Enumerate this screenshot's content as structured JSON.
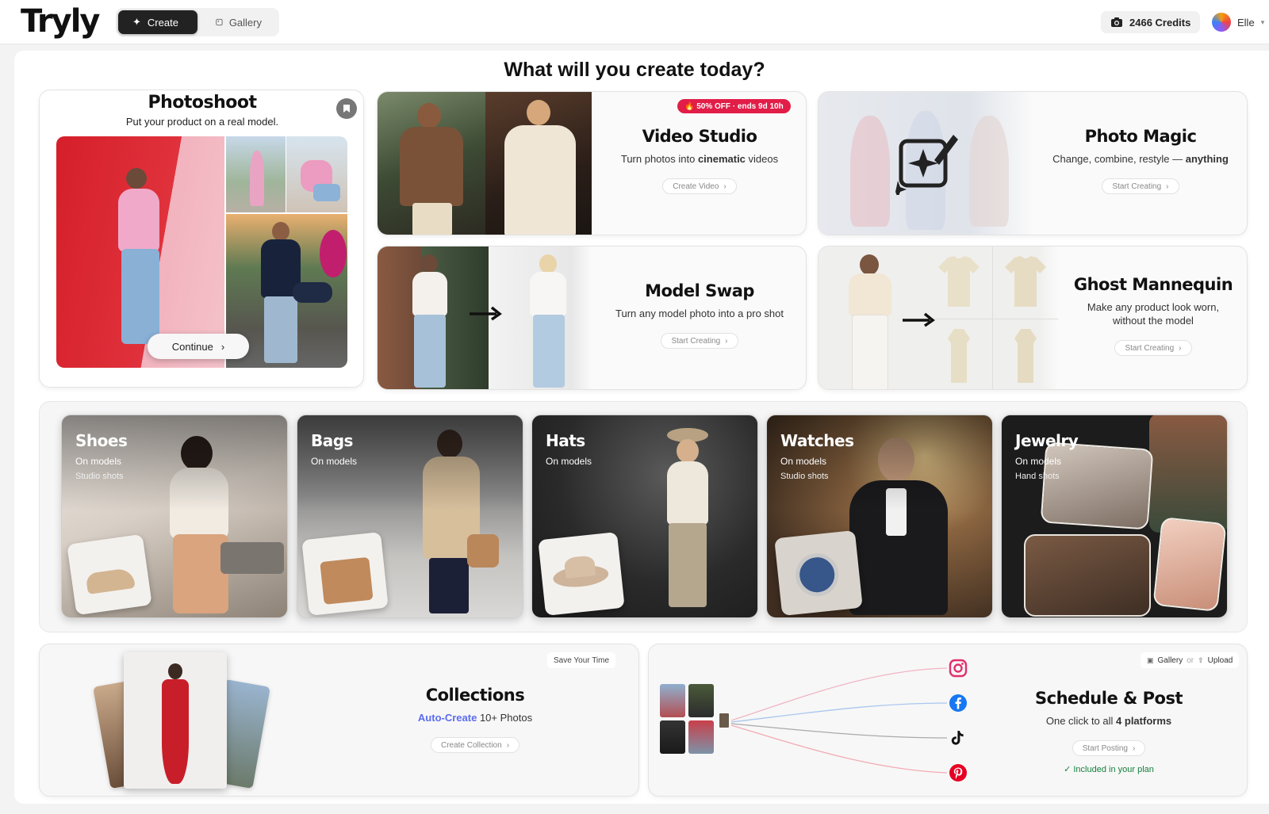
{
  "topbar": {
    "logo": "Tryly",
    "nav_create": "Create",
    "nav_gallery": "Gallery",
    "credits": "2466 Credits",
    "user_name": "Elle"
  },
  "page_title": "What will you create today?",
  "photoshoot": {
    "title": "Photoshoot",
    "subtitle": "Put your product on a real model.",
    "continue_label": "Continue"
  },
  "video_studio": {
    "badge": "🔥 50% OFF · ends 9d 10h",
    "title": "Video Studio",
    "subtitle_pre": "Turn photos into ",
    "subtitle_bold": "cinematic",
    "subtitle_post": " videos",
    "button": "Create Video"
  },
  "photo_magic": {
    "title": "Photo Magic",
    "subtitle_pre": "Change, combine, restyle — ",
    "subtitle_bold": "anything",
    "button": "Start Creating"
  },
  "model_swap": {
    "title": "Model Swap",
    "subtitle": "Turn any model photo into a pro shot",
    "button": "Start Creating"
  },
  "ghost_mannequin": {
    "title": "Ghost Mannequin",
    "subtitle_line1": "Make any product look worn,",
    "subtitle_line2": "without the model",
    "button": "Start Creating"
  },
  "categories": [
    {
      "name": "Shoes",
      "line1": "On models",
      "line2": "Studio shots"
    },
    {
      "name": "Bags",
      "line1": "On models",
      "line2": ""
    },
    {
      "name": "Hats",
      "line1": "On models",
      "line2": ""
    },
    {
      "name": "Watches",
      "line1": "On models",
      "line2": "Studio shots"
    },
    {
      "name": "Jewelry",
      "line1": "On models",
      "line2": "Hand shots"
    }
  ],
  "collections": {
    "tag": "Save Your Time",
    "title": "Collections",
    "subtitle_highlight": "Auto-Create",
    "subtitle_rest": " 10+ Photos",
    "button": "Create Collection"
  },
  "schedule": {
    "gallery_label": "Gallery",
    "or_label": "or",
    "upload_label": "Upload",
    "title": "Schedule & Post",
    "subtitle_pre": "One click to all ",
    "subtitle_bold": "4 platforms",
    "button": "Start Posting",
    "included": "Included in your plan"
  },
  "colors": {
    "accent_dark": "#222222",
    "badge_red": "#e11d48",
    "instagram": "#e1306c",
    "facebook": "#1877f2",
    "pinterest": "#e60023",
    "included_green": "#15803d"
  }
}
